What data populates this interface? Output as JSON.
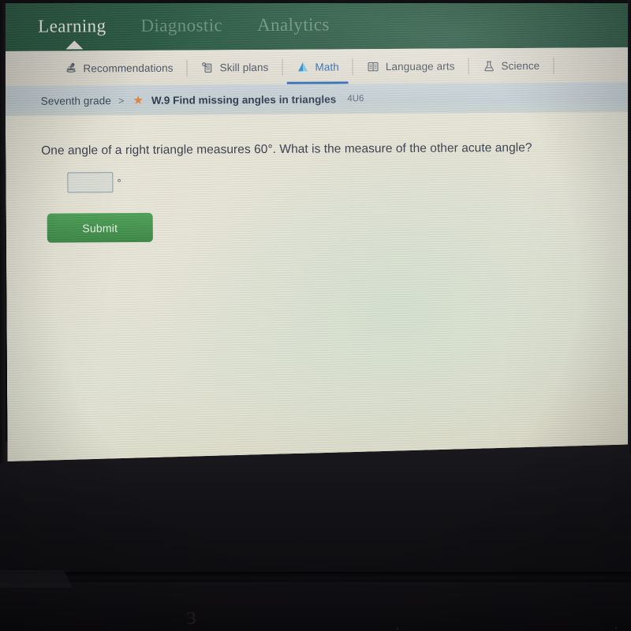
{
  "top_nav": {
    "items": [
      {
        "label": "Learning",
        "state": "active",
        "icon": "none"
      },
      {
        "label": "Diagnostic",
        "state": "dim",
        "icon": "none"
      },
      {
        "label": "Analytics",
        "state": "dim",
        "icon": "none"
      }
    ]
  },
  "tab_bar": {
    "tabs": [
      {
        "label": "Recommendations",
        "icon": "recommendations-icon",
        "active": false
      },
      {
        "label": "Skill plans",
        "icon": "skill-plans-icon",
        "active": false
      },
      {
        "label": "Math",
        "icon": "math-pyramid-icon",
        "active": true
      },
      {
        "label": "Language arts",
        "icon": "open-book-icon",
        "active": false
      },
      {
        "label": "Science",
        "icon": "flask-icon",
        "active": false
      }
    ]
  },
  "breadcrumb": {
    "grade": "Seventh grade",
    "separator": ">",
    "star": "★",
    "skill": "W.9 Find missing angles in triangles",
    "code": "4U6"
  },
  "main": {
    "question": "One angle of a right triangle measures 60°. What is the measure of the other acute angle?",
    "answer_value": "",
    "answer_placeholder": "",
    "degree_symbol": "°",
    "submit_label": "Submit"
  },
  "colors": {
    "header_green": "#2d5e47",
    "submit_green": "#46954f",
    "active_tab_blue": "#2f6fb5",
    "star_orange": "#e8833a",
    "breadcrumb_band": "#c6d2d7",
    "tab_band": "#e5e1d6",
    "content_bg": "#e6e6d8"
  },
  "device": {
    "logo_glyph": "з"
  }
}
